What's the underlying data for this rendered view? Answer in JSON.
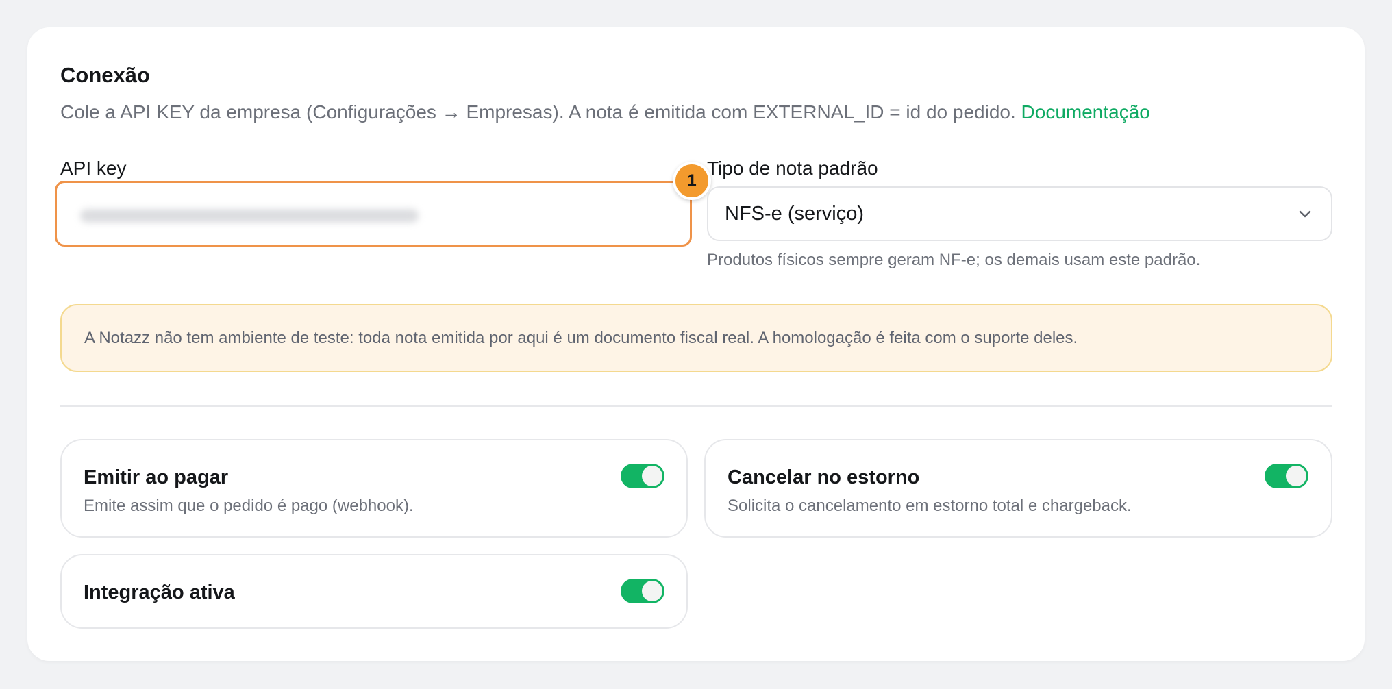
{
  "connection": {
    "title": "Conexão",
    "subtitle": "Cole a API KEY da empresa (Configurações → Empresas). A nota é emitida com EXTERNAL_ID = id do pedido.",
    "doc_link": "Documentação"
  },
  "api_key": {
    "label": "API key",
    "badge": "1"
  },
  "note_type": {
    "label": "Tipo de nota padrão",
    "selected": "NFS-e (serviço)",
    "hint": "Produtos físicos sempre geram NF-e; os demais usam este padrão."
  },
  "warning": {
    "text": "A Notazz não tem ambiente de teste: toda nota emitida por aqui é um documento fiscal real. A homologação é feita com o suporte deles."
  },
  "options": [
    {
      "title": "Emitir ao pagar",
      "description": "Emite assim que o pedido é pago (webhook).",
      "enabled": true
    },
    {
      "title": "Cancelar no estorno",
      "description": "Solicita o cancelamento em estorno total e chargeback.",
      "enabled": true
    },
    {
      "title": "Integração ativa",
      "description": "",
      "enabled": true
    }
  ],
  "colors": {
    "accent": "#0faa63",
    "toggle_on": "#12b464",
    "focus_border": "#ef9349",
    "badge": "#f39a2d"
  }
}
